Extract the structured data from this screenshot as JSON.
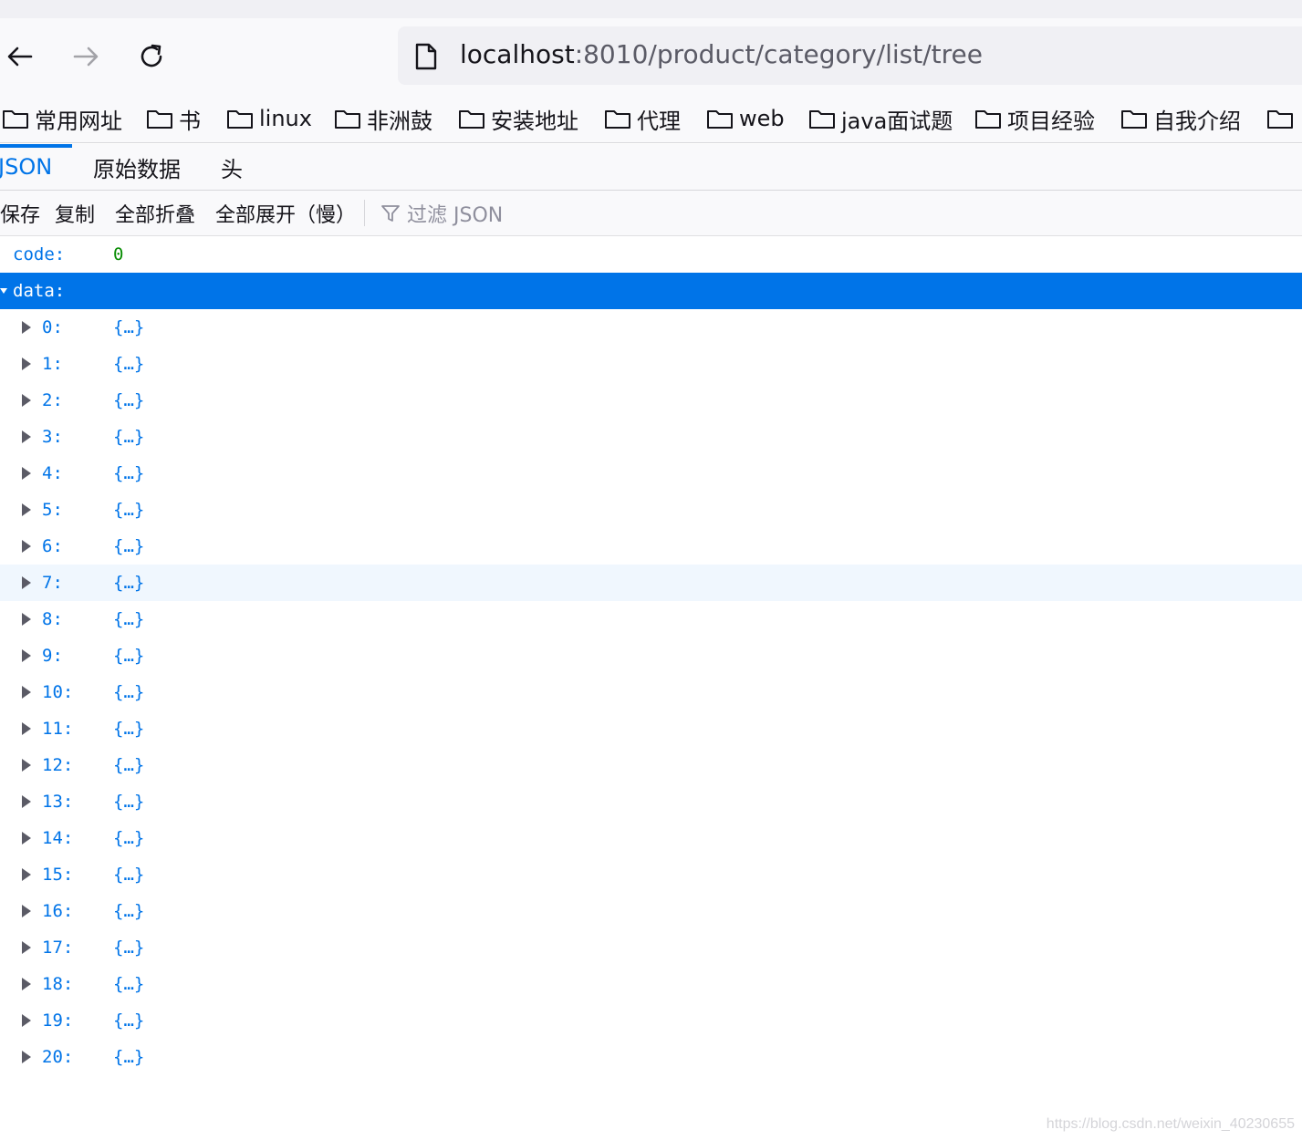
{
  "browser": {
    "url_host": "localhost",
    "url_rest": ":8010/product/category/list/tree"
  },
  "bookmarks": [
    {
      "label": "常用网址"
    },
    {
      "label": "书"
    },
    {
      "label": "linux"
    },
    {
      "label": "非洲鼓"
    },
    {
      "label": "安装地址"
    },
    {
      "label": "代理"
    },
    {
      "label": "web"
    },
    {
      "label": "java面试题"
    },
    {
      "label": "项目经验"
    },
    {
      "label": "自我介绍"
    },
    {
      "label": ""
    }
  ],
  "viewer": {
    "tabs": [
      "JSON",
      "原始数据",
      "头"
    ],
    "toolbar": {
      "save": "保存",
      "copy": "复制",
      "collapse_all": "全部折叠",
      "expand_all": "全部展开（慢）",
      "filter_placeholder": "过滤 JSON"
    }
  },
  "json": {
    "code_key": "code:",
    "code_value": "0",
    "data_key": "data:",
    "items": [
      {
        "key": "0:",
        "value": "{…}"
      },
      {
        "key": "1:",
        "value": "{…}"
      },
      {
        "key": "2:",
        "value": "{…}"
      },
      {
        "key": "3:",
        "value": "{…}"
      },
      {
        "key": "4:",
        "value": "{…}"
      },
      {
        "key": "5:",
        "value": "{…}"
      },
      {
        "key": "6:",
        "value": "{…}"
      },
      {
        "key": "7:",
        "value": "{…}"
      },
      {
        "key": "8:",
        "value": "{…}"
      },
      {
        "key": "9:",
        "value": "{…}"
      },
      {
        "key": "10:",
        "value": "{…}"
      },
      {
        "key": "11:",
        "value": "{…}"
      },
      {
        "key": "12:",
        "value": "{…}"
      },
      {
        "key": "13:",
        "value": "{…}"
      },
      {
        "key": "14:",
        "value": "{…}"
      },
      {
        "key": "15:",
        "value": "{…}"
      },
      {
        "key": "16:",
        "value": "{…}"
      },
      {
        "key": "17:",
        "value": "{…}"
      },
      {
        "key": "18:",
        "value": "{…}"
      },
      {
        "key": "19:",
        "value": "{…}"
      },
      {
        "key": "20:",
        "value": "{…}"
      }
    ]
  },
  "watermark": "https://blog.csdn.net/weixin_40230655",
  "colors": {
    "accent": "#0074e8",
    "number": "#058b00",
    "selected_row": "#0074e8",
    "hover_row": "#f0f7fe"
  }
}
